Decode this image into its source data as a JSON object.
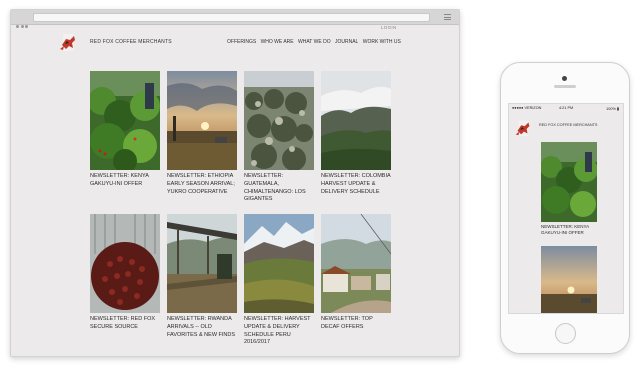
{
  "site": {
    "name": "RED FOX COFFEE MERCHANTS",
    "login": "LOGIN",
    "nav": [
      "OFFERINGS",
      "WHO WE ARE",
      "WHAT WE DO",
      "JOURNAL",
      "WORK WITH US"
    ]
  },
  "posts": [
    {
      "caption": "NEWSLETTER: KENYA GAKUYU-INI OFFER"
    },
    {
      "caption": "NEWSLETTER: ETHIOPIA EARLY SEASON ARRIVAL; YUKRO COOPERATIVE"
    },
    {
      "caption": "NEWSLETTER: GUATEMALA, CHIMALTENANGO: LOS GIGANTES"
    },
    {
      "caption": "NEWSLETTER: COLOMBIA HARVEST UPDATE & DELIVERY SCHEDULE"
    },
    {
      "caption": "NEWSLETTER: RED FOX SECURE SOURCE"
    },
    {
      "caption": "NEWSLETTER: RWANDA ARRIVALS -- OLD FAVORITES & NEW FINDS"
    },
    {
      "caption": "NEWSLETTER: HARVEST UPDATE & DELIVERY SCHEDULE PERU 2016/2017"
    },
    {
      "caption": "NEWSLETTER: TOP DECAF OFFERS"
    }
  ],
  "mobile": {
    "carrier": "VERIZON",
    "time": "4:21 PM",
    "battery": "100%",
    "site_name": "RED FOX COFFEE MERCHANTS",
    "posts": [
      {
        "caption": "NEWSLETTER: KENYA GAKUYU-INI OFFER"
      }
    ]
  },
  "icons": [
    "fox-logo-icon",
    "browser-menu-icon",
    "signal-icon",
    "battery-icon"
  ]
}
